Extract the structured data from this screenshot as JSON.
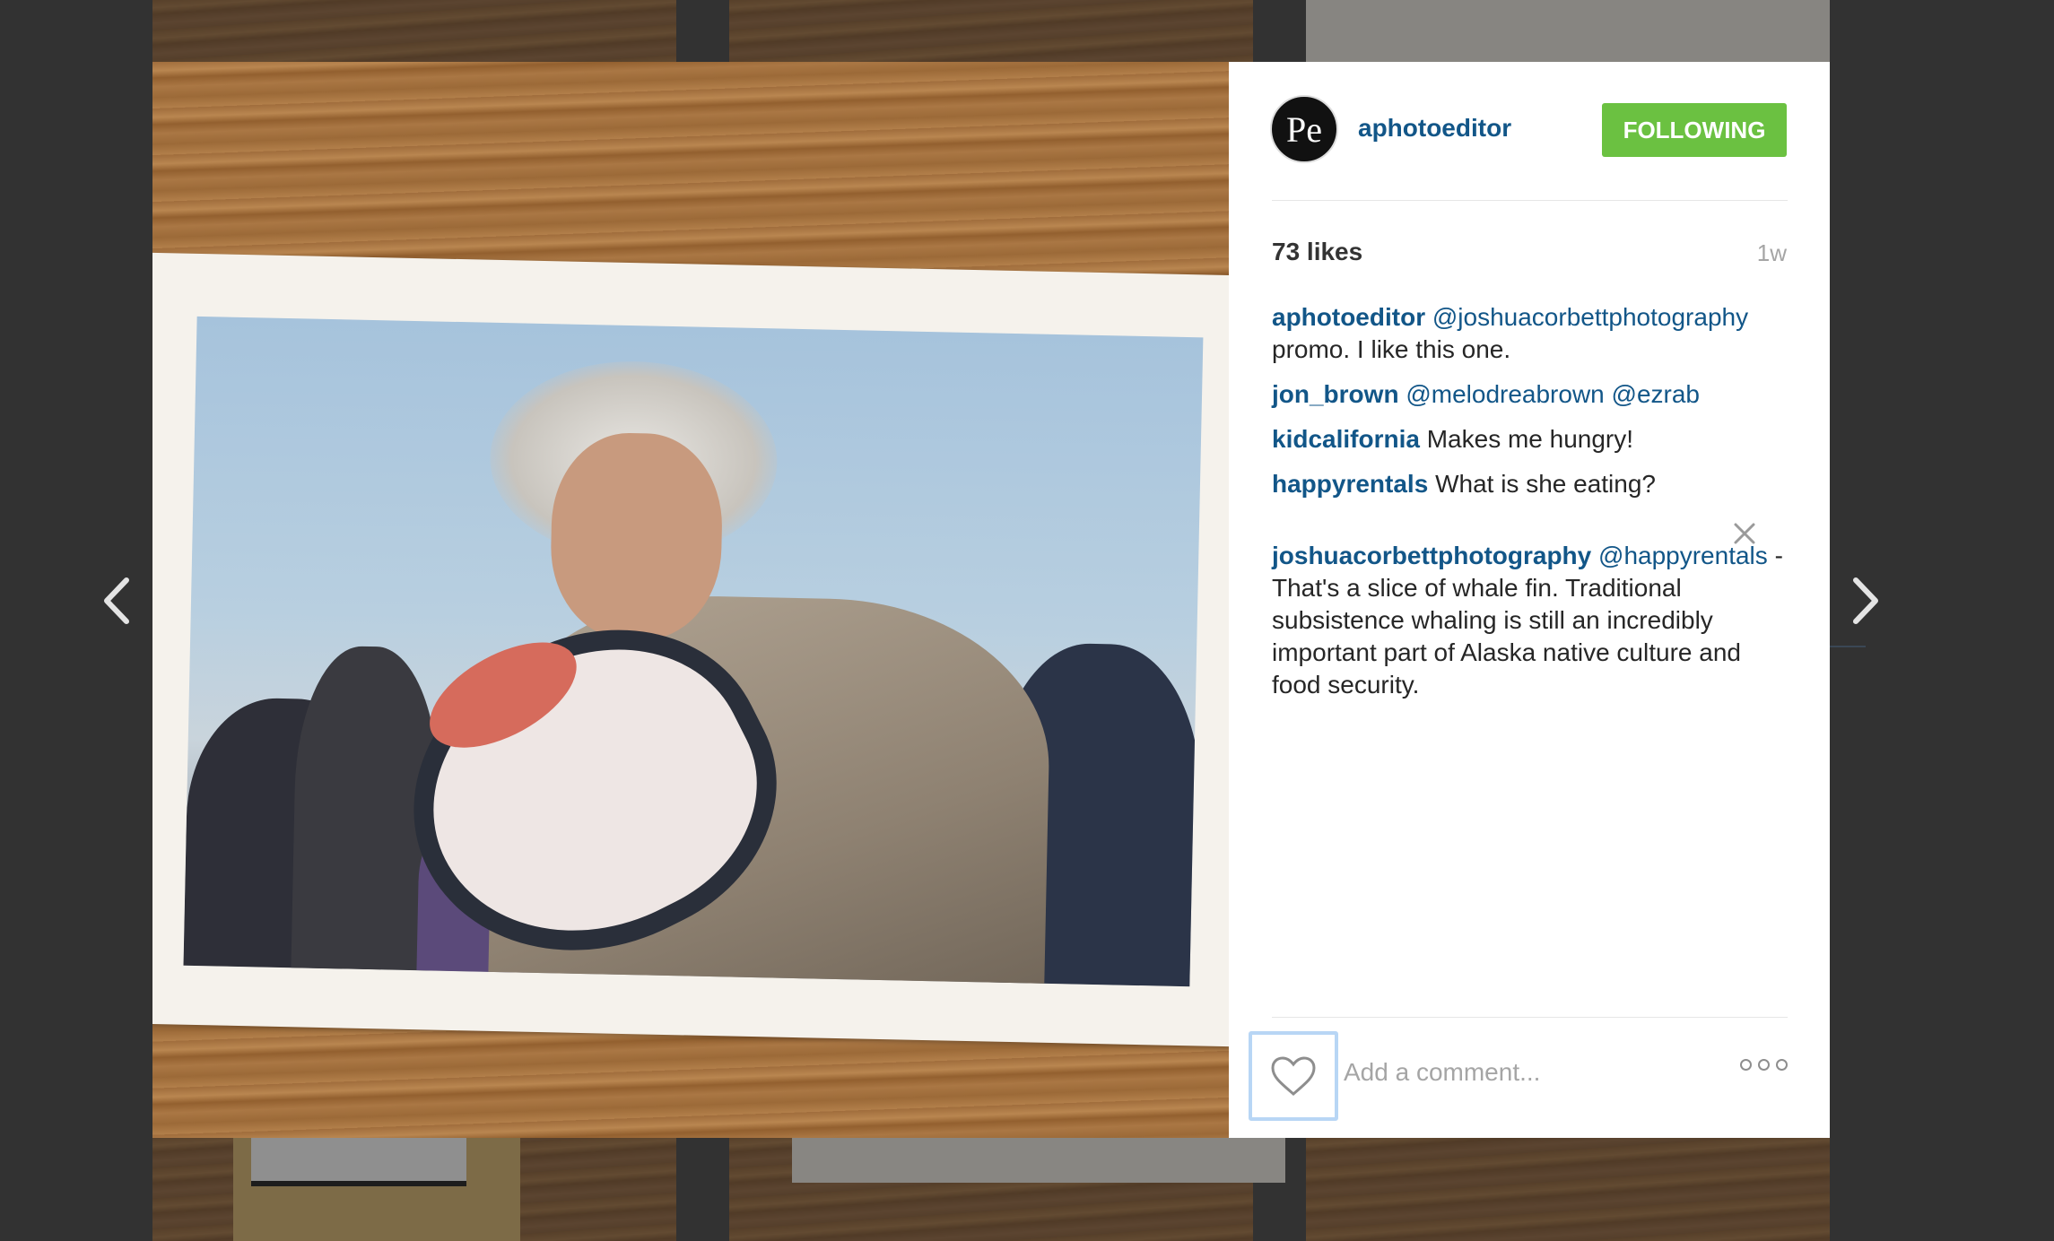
{
  "post": {
    "owner": "aphotoeditor",
    "avatar_text": "Pe",
    "follow_button": "FOLLOWING",
    "likes": "73 likes",
    "age": "1w",
    "comments": [
      {
        "user": "aphotoeditor",
        "mention": "@joshuacorbettphotography",
        "text": "promo. I like this one."
      },
      {
        "user": "jon_brown",
        "mention": "@melodreabrown @ezrab",
        "text": ""
      },
      {
        "user": "kidcalifornia",
        "mention": "",
        "text": "Makes me hungry!"
      },
      {
        "user": "happyrentals",
        "mention": "",
        "text": "What is she eating?"
      },
      {
        "user": "joshuacorbettphotography",
        "mention": "@happyrentals",
        "text": "- That's a slice of whale fin. Traditional subsistence whaling is still an incredibly important part of Alaska native culture and food security."
      }
    ],
    "comment_placeholder": "Add a comment..."
  },
  "icons": {
    "like": "heart-icon",
    "more": "more-options-icon",
    "delete": "close-icon",
    "prev": "chevron-left-icon",
    "next": "chevron-right-icon"
  },
  "colors": {
    "follow_button": "#6bc141",
    "username": "#125688",
    "overlay": "#3d3d3d"
  }
}
